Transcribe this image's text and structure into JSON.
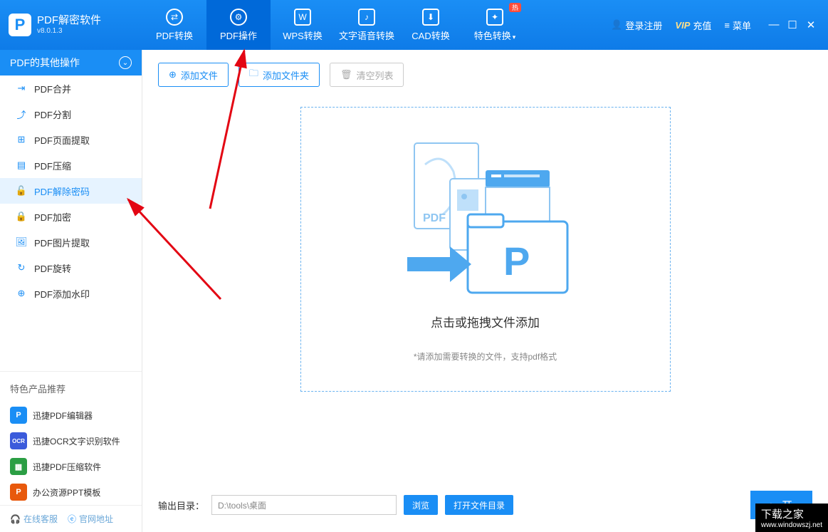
{
  "app": {
    "title": "PDF解密软件",
    "version": "v8.0.1.3"
  },
  "nav": {
    "tabs": [
      {
        "label": "PDF转换"
      },
      {
        "label": "PDF操作"
      },
      {
        "label": "WPS转换"
      },
      {
        "label": "文字语音转换"
      },
      {
        "label": "CAD转换"
      },
      {
        "label": "特色转换"
      }
    ],
    "hot_badge": "热"
  },
  "header_right": {
    "login": "登录注册",
    "vip_prefix": "VIP",
    "vip_label": "充值",
    "menu": "菜单"
  },
  "sidebar": {
    "header": "PDF的其他操作",
    "items": [
      {
        "label": "PDF合并"
      },
      {
        "label": "PDF分割"
      },
      {
        "label": "PDF页面提取"
      },
      {
        "label": "PDF压缩"
      },
      {
        "label": "PDF解除密码"
      },
      {
        "label": "PDF加密"
      },
      {
        "label": "PDF图片提取"
      },
      {
        "label": "PDF旋转"
      },
      {
        "label": "PDF添加水印"
      }
    ],
    "promo_title": "特色产品推荐",
    "promos": [
      {
        "label": "迅捷PDF编辑器",
        "color": "#1a8ef5",
        "tag": "P"
      },
      {
        "label": "迅捷OCR文字识别软件",
        "color": "#3b5bdb",
        "tag": "OCR"
      },
      {
        "label": "迅捷PDF压缩软件",
        "color": "#2b9e44",
        "tag": "▦"
      },
      {
        "label": "办公资源PPT模板",
        "color": "#e8590c",
        "tag": "P"
      }
    ],
    "footer": {
      "service": "在线客服",
      "site": "官网地址"
    }
  },
  "toolbar": {
    "add_file": "添加文件",
    "add_folder": "添加文件夹",
    "clear_list": "清空列表"
  },
  "drop": {
    "main_text": "点击或拖拽文件添加",
    "hint": "*请添加需要转换的文件，支持pdf格式"
  },
  "output": {
    "label": "输出目录：",
    "path": "D:\\tools\\桌面",
    "browse": "浏览",
    "open_dir": "打开文件目录",
    "start": "开"
  },
  "watermark": {
    "line1": "下载之家",
    "line2": "www.windowszj.net"
  }
}
